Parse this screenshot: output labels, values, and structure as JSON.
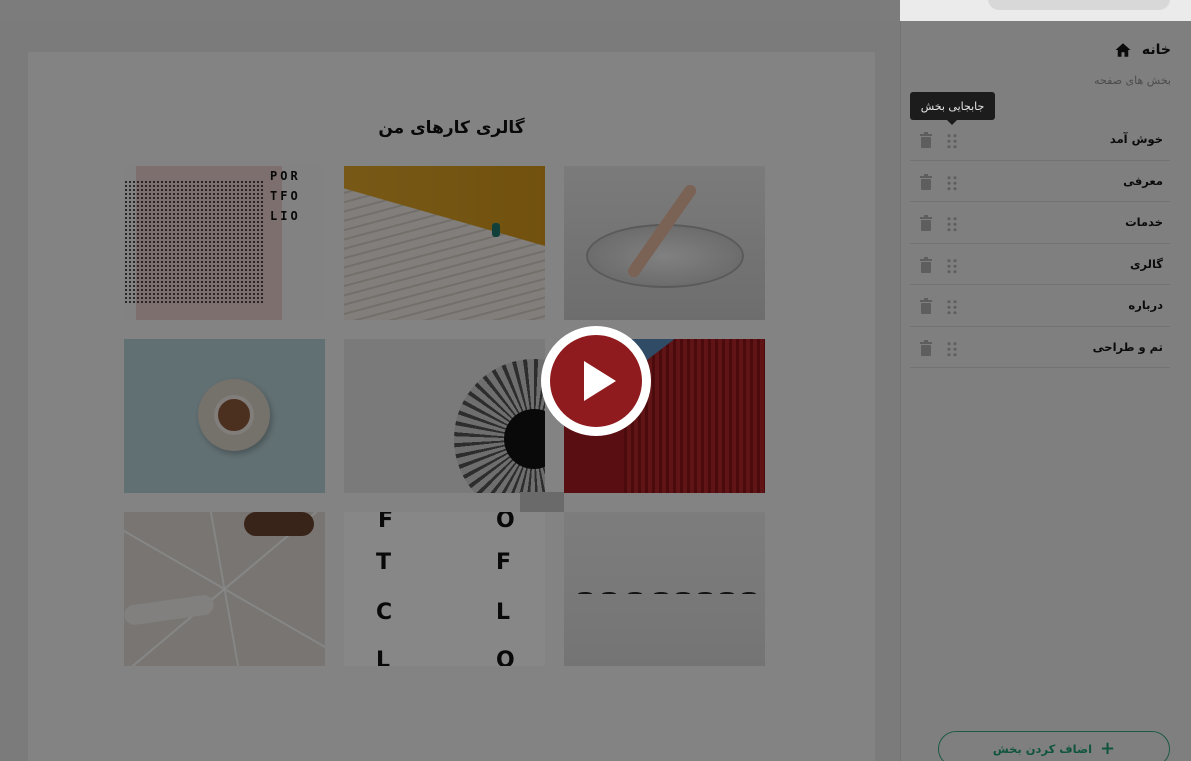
{
  "sidebar": {
    "breadcrumb_label": "خانه",
    "subtitle": "بخش های صفحه",
    "tooltip": "جابجایی بخش",
    "sections": [
      {
        "label": "خوش آمد"
      },
      {
        "label": "معرفی"
      },
      {
        "label": "خدمات"
      },
      {
        "label": "گالری"
      },
      {
        "label": "درباره"
      },
      {
        "label": "تم و طراحی"
      }
    ],
    "add_button_label": "اضاف کردن بخش",
    "add_button_icon": "plus-icon"
  },
  "canvas": {
    "gallery_title": "گالری کارهای من",
    "portfolio_lines": [
      "POR",
      "TFO",
      "LIO"
    ],
    "poster_letters": [
      "F",
      "O",
      "T",
      "F",
      "C",
      "L",
      "L",
      "O"
    ]
  },
  "video": {
    "play_icon": "play-icon",
    "accent_color": "#8f1b1f"
  },
  "colors": {
    "accent_green": "#11553f",
    "overlay": "rgba(0,0,0,0.47)"
  }
}
